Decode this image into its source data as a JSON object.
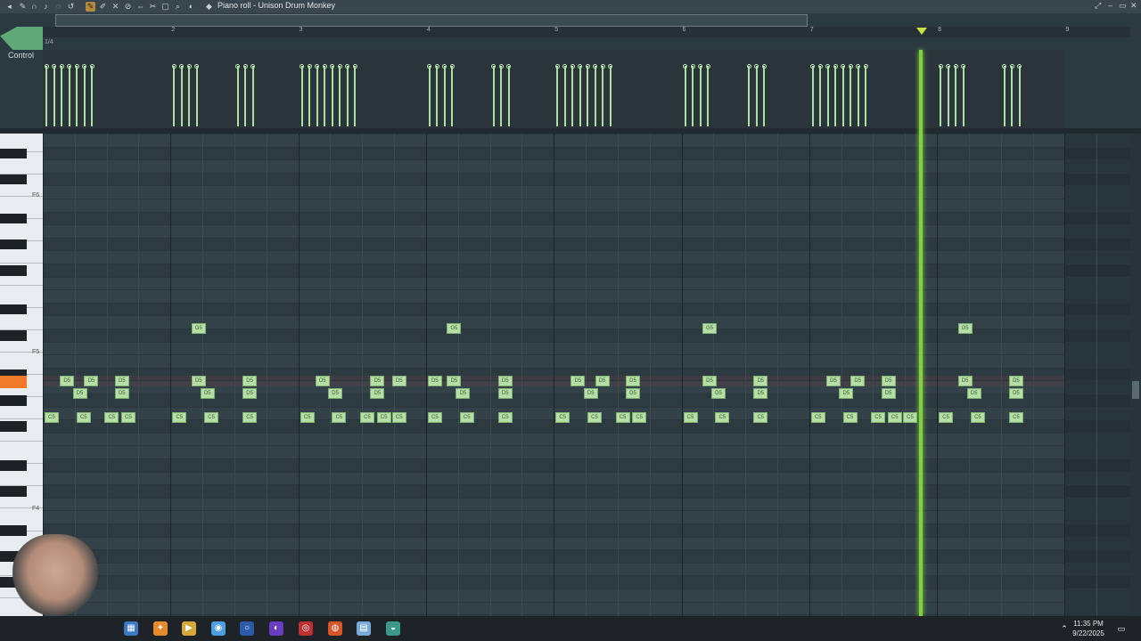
{
  "window": {
    "title": "Piano roll - Unison Drum Monkey"
  },
  "control": {
    "label": "Control"
  },
  "ruler": {
    "bars": [
      "2",
      "3",
      "4",
      "5",
      "6",
      "7",
      "8",
      "9"
    ],
    "snap_label": "1/4"
  },
  "keyboard": {
    "labels": [
      "F6",
      "F5",
      "F4"
    ]
  },
  "notes": {
    "d5": "D5",
    "c5": "C5",
    "g5": "G5"
  },
  "clock": {
    "time": "11:35 PM",
    "date": "9/22/2025"
  },
  "colors": {
    "note": "#b6dfa6",
    "playhead": "#7fd23a",
    "grid": "#334249",
    "active_key": "#f07a2a"
  },
  "icons": [
    "menu-arrow-icon",
    "pencil-icon",
    "brush-icon",
    "delete-icon",
    "mute-icon",
    "slice-icon",
    "select-icon",
    "zoom-icon",
    "play-icon",
    "speaker-icon"
  ]
}
